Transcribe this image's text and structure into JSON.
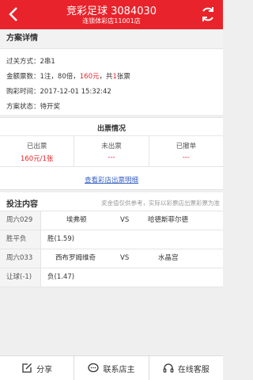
{
  "header": {
    "title": "竞彩足球 3084030",
    "subtitle": "连锁体彩店11001店"
  },
  "details": {
    "section_title": "方案详情",
    "pass_label": "过关方式：",
    "pass_value": "2串1",
    "amount_label": "金额票数：",
    "amount_prefix": "1注，80倍，",
    "amount_money": "160元",
    "amount_mid": "，共",
    "amount_count": "1",
    "amount_suffix": "张票",
    "time_label": "购彩时间：",
    "time_value": "2017-12-01 15:32:42",
    "status_label": "方案状态：",
    "status_value": "待开奖"
  },
  "ticket": {
    "title": "出票情况",
    "issued_label": "已出票",
    "issued_value": "160元/1张",
    "pending_label": "未出票",
    "pending_value": "---",
    "cancelled_label": "已撤单",
    "cancelled_value": "---",
    "link": "查看彩店出票明细"
  },
  "bets": {
    "title": "投注内容",
    "note": "奖金值仅供参考，实际以彩票店出票彩票为准",
    "rows": [
      {
        "label": "周六029",
        "home": "埃弗顿",
        "vs": "VS",
        "away": "哈德斯菲尔德"
      },
      {
        "label": "胜平负",
        "pick": "胜(1.59)"
      },
      {
        "label": "周六033",
        "home": "西布罗姆维奇",
        "vs": "VS",
        "away": "水晶宫"
      },
      {
        "label": "让球(-1)",
        "pick": "负(1.47)"
      }
    ]
  },
  "footer": {
    "share": "分享",
    "contact": "联系店主",
    "service": "在线客服"
  },
  "colors": {
    "brand": "#e8232b",
    "link": "#3a63c5"
  }
}
